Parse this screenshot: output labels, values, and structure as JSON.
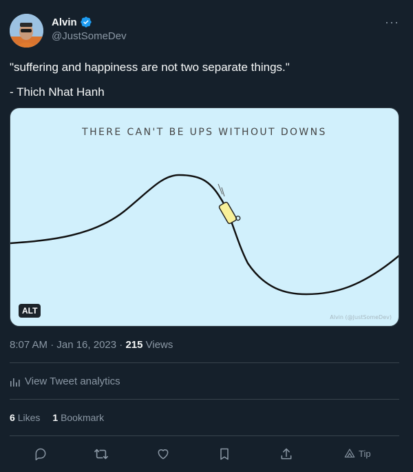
{
  "author": {
    "name": "Alvin",
    "handle": "@JustSomeDev",
    "avatar_icon": "avatar-photo",
    "verified_icon": "verified-badge-icon"
  },
  "tweet": {
    "line1": "\"suffering and happiness are not two separate things.\"",
    "line2": "- Thich Nhat Hanh"
  },
  "media": {
    "title": "THERE CAN'T BE UPS WITHOUT DOWNS",
    "credit": "Alvin (@JustSomeDev)",
    "alt_label": "ALT",
    "background": "#d1f0fc"
  },
  "meta": {
    "time_date": "8:07 AM · Jan 16, 2023 · ",
    "views_count": "215",
    "views_label": " Views"
  },
  "analytics": {
    "label": "View Tweet analytics"
  },
  "stats": {
    "likes_count": "6",
    "likes_label": "Likes",
    "bookmarks_count": "1",
    "bookmarks_label": "Bookmark"
  },
  "actions": {
    "reply_icon": "reply-icon",
    "retweet_icon": "retweet-icon",
    "like_icon": "like-icon",
    "bookmark_icon": "bookmark-icon",
    "share_icon": "share-icon",
    "tip_label": "Tip"
  },
  "colors": {
    "background": "#15202b",
    "text_primary": "#f7f9f9",
    "text_secondary": "#8b98a5",
    "accent": "#1d9bf0"
  }
}
